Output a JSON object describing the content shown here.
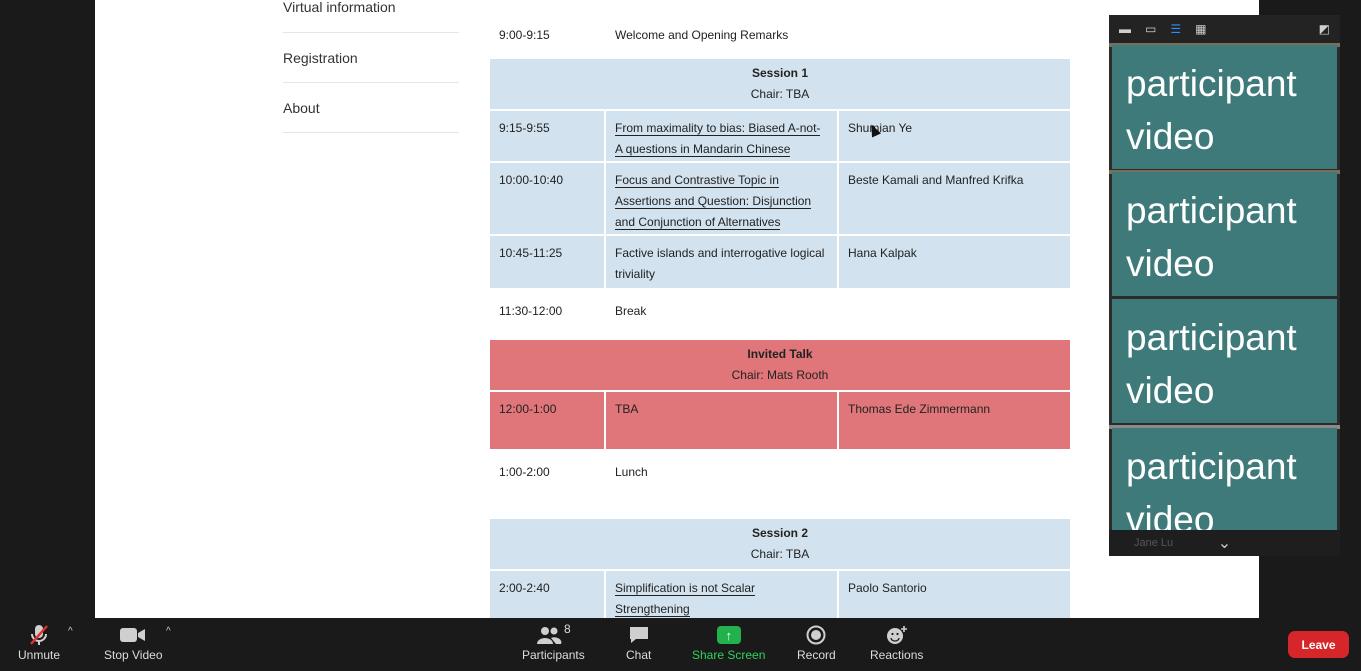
{
  "sidebar": {
    "items": [
      {
        "label": "Virtual information"
      },
      {
        "label": "Registration"
      },
      {
        "label": "About"
      }
    ]
  },
  "schedule": {
    "opening": {
      "time": "9:00-9:15",
      "title": "Welcome and Opening Remarks"
    },
    "session1": {
      "title": "Session 1",
      "chair": "Chair: TBA",
      "talks": [
        {
          "time": "9:15-9:55",
          "title": "From maximality to bias: Biased A-not-A questions in Mandarin Chinese",
          "speaker": "Shumian Ye"
        },
        {
          "time": "10:00-10:40",
          "title": "Focus and Contrastive Topic in Assertions and Question: Disjunction and Conjunction of Alternatives",
          "speaker": "Beste Kamali and Manfred Krifka"
        },
        {
          "time": "10:45-11:25",
          "title": "Factive islands and interrogative logical triviality",
          "speaker": "Hana Kalpak"
        }
      ]
    },
    "break": {
      "time": "11:30-12:00",
      "title": "Break"
    },
    "invited": {
      "title": "Invited Talk",
      "chair": "Chair: Mats Rooth",
      "talk": {
        "time": "12:00-1:00",
        "title": "TBA",
        "speaker": "Thomas Ede Zimmermann"
      }
    },
    "lunch": {
      "time": "1:00-2:00",
      "title": "Lunch"
    },
    "session2": {
      "title": "Session 2",
      "chair": "Chair: TBA",
      "talks": [
        {
          "time": "2:00-2:40",
          "title": "Simplification is not Scalar Strengthening",
          "speaker": "Paolo Santorio"
        }
      ]
    }
  },
  "video_panel": {
    "tiles": [
      {
        "label": "participant video"
      },
      {
        "label": "participant video"
      },
      {
        "label": "participant video"
      },
      {
        "label": "participant video"
      }
    ],
    "footer_name": "Jane Lu"
  },
  "toolbar": {
    "unmute": "Unmute",
    "stop_video": "Stop Video",
    "participants": "Participants",
    "participants_count": "8",
    "chat": "Chat",
    "share_screen": "Share Screen",
    "record": "Record",
    "reactions": "Reactions",
    "leave": "Leave"
  },
  "colors": {
    "session_blue": "#d2e2ee",
    "invited_red": "#e07679",
    "tile_teal": "#3f7a7b",
    "share_green": "#22b14c",
    "leave_red": "#d7262a"
  }
}
